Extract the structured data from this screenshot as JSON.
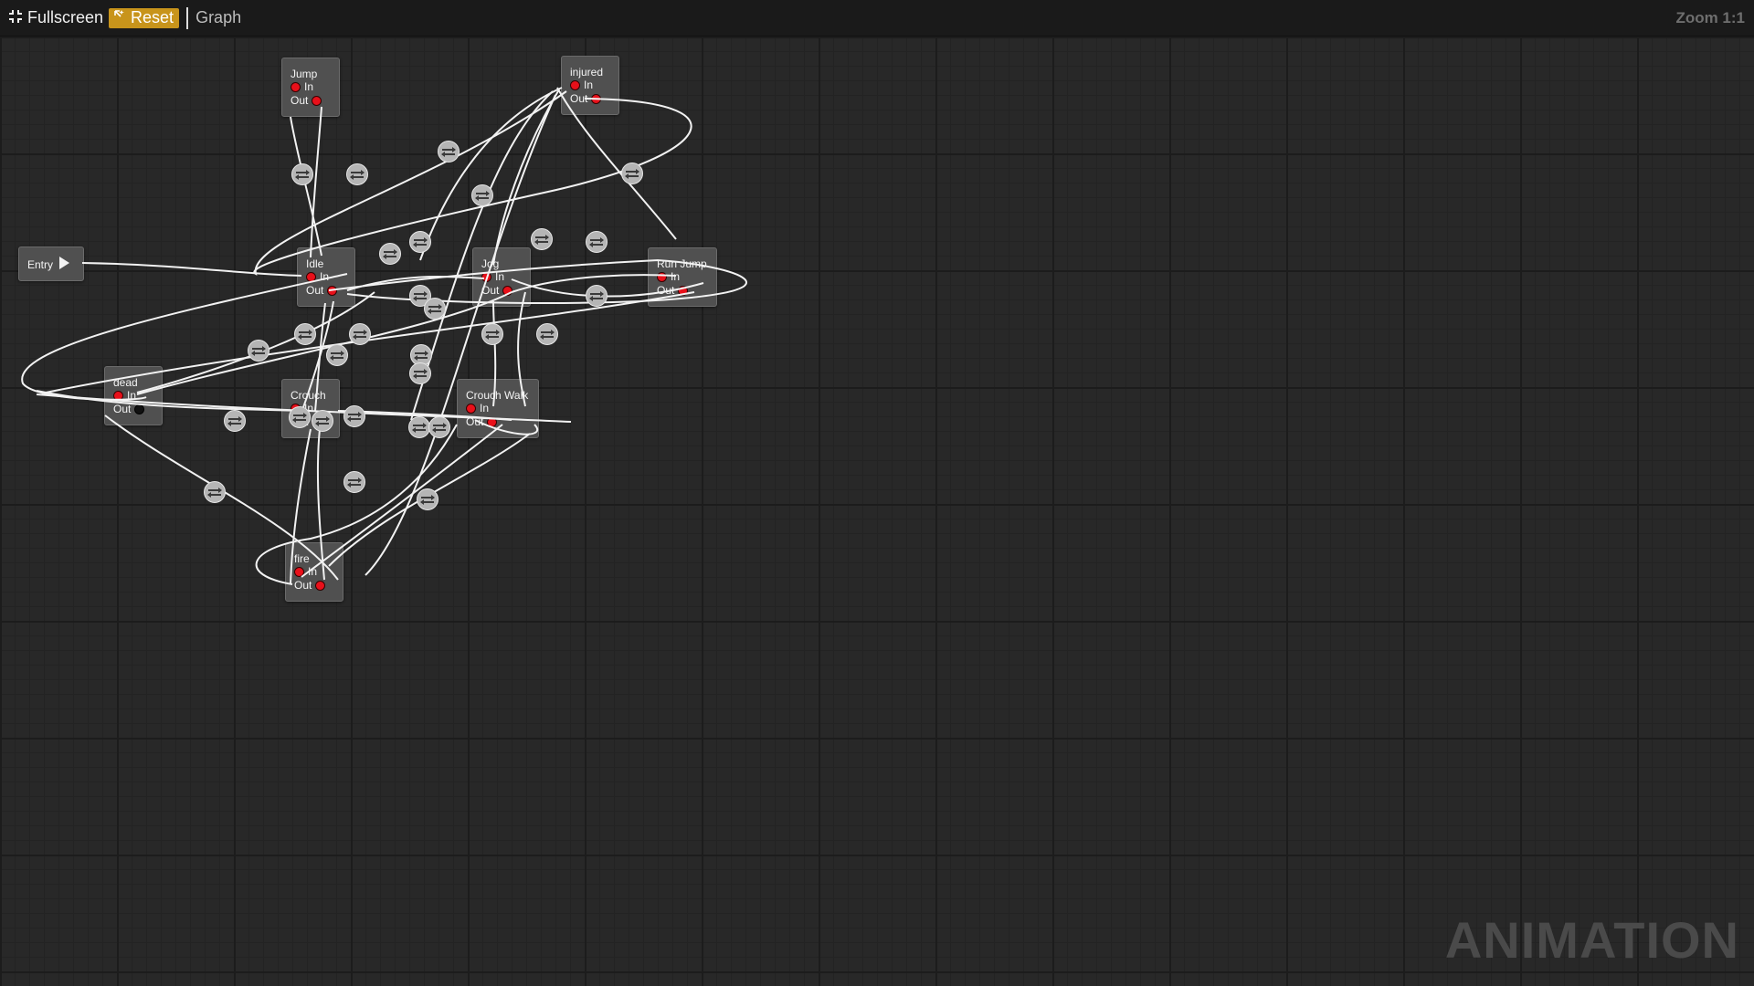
{
  "toolbar": {
    "fullscreen_label": "Fullscreen",
    "reset_label": "Reset",
    "graph_tab_label": "Graph",
    "zoom_label": "Zoom 1:1",
    "fullscreen_icon": "fullscreen-icon",
    "reset_icon": "reset-icon",
    "accent_color": "#c8941b"
  },
  "watermark": "ANIMATION",
  "entry_node": {
    "label": "Entry",
    "icon": "play-arrow-icon"
  },
  "ports": {
    "in_label": "In",
    "out_label": "Out"
  },
  "states": [
    {
      "id": "jump",
      "title": "Jump"
    },
    {
      "id": "injured",
      "title": "injured"
    },
    {
      "id": "idle",
      "title": "Idle"
    },
    {
      "id": "jog",
      "title": "Jog"
    },
    {
      "id": "run-jump",
      "title": "Run Jump"
    },
    {
      "id": "dead",
      "title": "dead"
    },
    {
      "id": "crouch",
      "title": "Crouch"
    },
    {
      "id": "crouch-walk",
      "title": "Crouch Walk"
    },
    {
      "id": "fire",
      "title": "fire"
    }
  ],
  "colors": {
    "canvas": "#282828",
    "node": "#505050",
    "port": "#e8101a",
    "edge": "#f2f2f2",
    "transition": "#b5b5b5"
  }
}
